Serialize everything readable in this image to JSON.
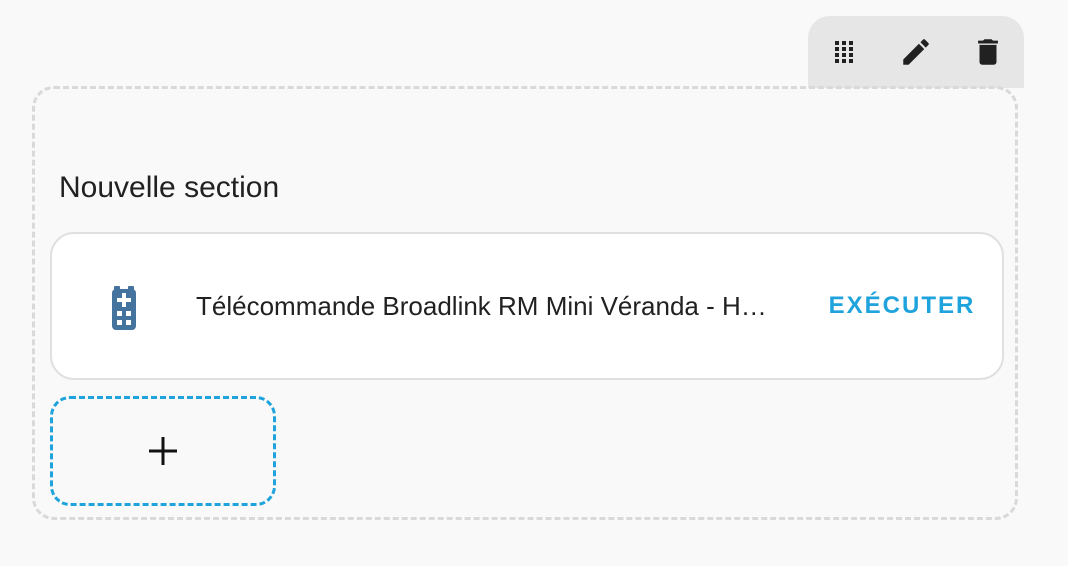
{
  "toolbar": {
    "icons": [
      "drag-handle-icon",
      "pencil-icon",
      "trash-icon"
    ],
    "background": "#e6e6e6"
  },
  "section": {
    "title": "Nouvelle section"
  },
  "entity": {
    "icon": "remote-control-icon",
    "name": "Télécommande Broadlink RM Mini Véranda - H…",
    "action_label": "EXÉCUTER",
    "action_color": "#1fa3dc",
    "icon_color": "#44739e"
  },
  "add_card": {
    "icon": "plus-icon",
    "border_color": "#1fa3dc"
  }
}
